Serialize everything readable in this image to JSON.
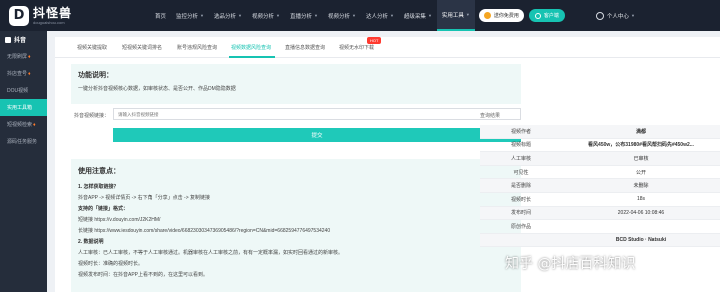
{
  "brand": {
    "name": "抖怪兽",
    "sub": "douguaishou.com",
    "mark": "D"
  },
  "nav": {
    "items": [
      {
        "label": "首页",
        "caret": false
      },
      {
        "label": "监控分析",
        "caret": true
      },
      {
        "label": "选品分析",
        "caret": true
      },
      {
        "label": "视频分析",
        "caret": true
      },
      {
        "label": "直播分析",
        "caret": true
      },
      {
        "label": "视频分析",
        "caret": true
      },
      {
        "label": "达人分析",
        "caret": true
      },
      {
        "label": "超级采集",
        "caret": true
      },
      {
        "label": "实用工具",
        "caret": true,
        "active": true
      }
    ],
    "free_btn": "送你免费用",
    "dl_btn": "客户端",
    "user": "个人中心"
  },
  "sidebar": {
    "head": "抖音",
    "items": [
      {
        "label": "无限刷屏",
        "hot": true
      },
      {
        "label": "抖店查号",
        "hot": true
      },
      {
        "label": "DOU视频"
      },
      {
        "label": "实用工具箱",
        "active": true
      },
      {
        "label": "短视频检索",
        "hot": true
      },
      {
        "label": "源码任务服务"
      }
    ]
  },
  "tabs": {
    "items": [
      "视频关键提取",
      "短视频关键词排名",
      "账号违规风险查询",
      "视频数据风险查询",
      "直播信息数据查询",
      "视频无水印下载"
    ],
    "hot": "HOT"
  },
  "func": {
    "title": "功能说明：",
    "desc": "一键分析抖音视频核心数据，如审核状态、是否公开、作品DM隐隐数据"
  },
  "input": {
    "label": "抖音视频链接：",
    "placeholder": "请输入抖音视频链接"
  },
  "submit": "提交",
  "notes": {
    "title": "使用注意点：",
    "lines": [
      {
        "text": "1. 怎样获取链接？",
        "bold": true
      },
      {
        "text": "抖音APP -> 视频详情页 -> 右下角「分享」点击 -> 复制链接"
      },
      {
        "text": "支持的「链接」格式：",
        "bold": true
      },
      {
        "text": "短链接 https://v.douyin.com/J2K2HM/"
      },
      {
        "text": "长链接 https://www.iesdouyin.com/share/video/6682303034736905486/?region=CN&mid=6682594776497534240"
      },
      {
        "text": "2. 数据说明",
        "bold": true
      },
      {
        "text": "人工审核：已人工审核，不等于人工审核通过。机器审核在人工审核之前，有有一定概率漏，如实时回看通过的新审核。"
      },
      {
        "text": "视频时长：准确的视频时长。"
      },
      {
        "text": "视频发布时间：在抖音APP上看不到的，在这里可以看到。"
      }
    ]
  },
  "result": {
    "title": "查询结果",
    "rows": [
      {
        "k": "视频作者",
        "v": "满都",
        "strong": true
      },
      {
        "k": "视频标题",
        "v": "看风450w，公布31980#看风帮扫码先#450w2...",
        "strong": true
      },
      {
        "k": "人工审核",
        "v": "已审核"
      },
      {
        "k": "可见性",
        "v": "公开"
      },
      {
        "k": "是否删除",
        "v": "未删除"
      },
      {
        "k": "视频时长",
        "v": "18s"
      },
      {
        "k": "发布时间",
        "v": "2022-04-06 10:08:46"
      },
      {
        "k": "原创作品",
        "v": ""
      },
      {
        "k": "",
        "v": "BCD Studio · Natsuki",
        "strong": true
      }
    ]
  },
  "watermark": "知乎 @抖店百科知识"
}
